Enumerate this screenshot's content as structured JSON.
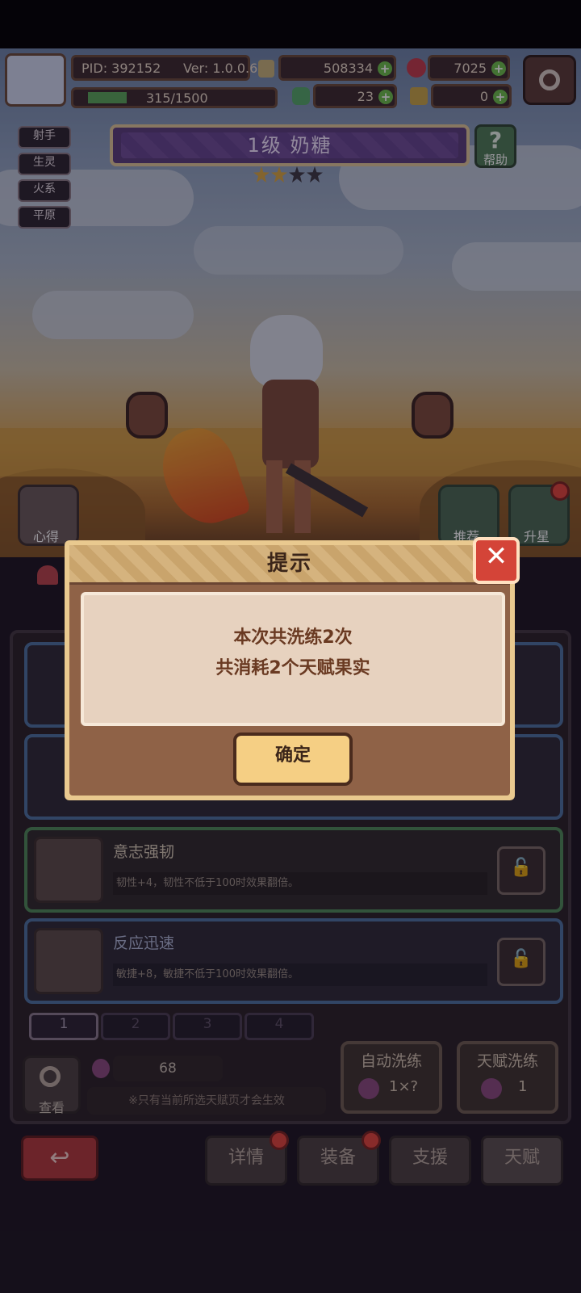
{
  "header": {
    "pid": "PID: 392152",
    "version": "Ver: 1.0.0.6",
    "gold": "508334",
    "gems": "7025",
    "exp": "315/1500",
    "exp_fraction": 0.21,
    "clover": "23",
    "keys": "0"
  },
  "tags": [
    "射手",
    "生灵",
    "火系",
    "平原"
  ],
  "character": {
    "name": "1级  奶糖",
    "stars_total": 4,
    "stars_filled": 2
  },
  "help_label": "帮助",
  "side_buttons": {
    "left": "心得",
    "recommend": "推荐",
    "star_up": "升星"
  },
  "talents": [
    {
      "title": "意志强韧",
      "desc": "韧性+4，韧性不低于100时效果翻倍。"
    },
    {
      "title": "反应迅速",
      "desc": "敏捷+8，敏捷不低于100时效果翻倍。"
    }
  ],
  "pages": [
    "1",
    "2",
    "3",
    "4"
  ],
  "footer": {
    "search_label": "查看",
    "fruit_count": "68",
    "note": "※只有当前所选天赋页才会生效",
    "auto_wash_label": "自动洗练",
    "auto_wash_cost": "1×?",
    "talent_wash_label": "天赋洗练",
    "talent_wash_cost": "1"
  },
  "bottom_nav": {
    "details": "详情",
    "equipment": "装备",
    "support": "支援",
    "talent": "天赋"
  },
  "modal": {
    "title": "提示",
    "line1": "本次共洗练2次",
    "line2": "共消耗2个天赋果实",
    "ok": "确定",
    "close_symbol": "✕"
  }
}
